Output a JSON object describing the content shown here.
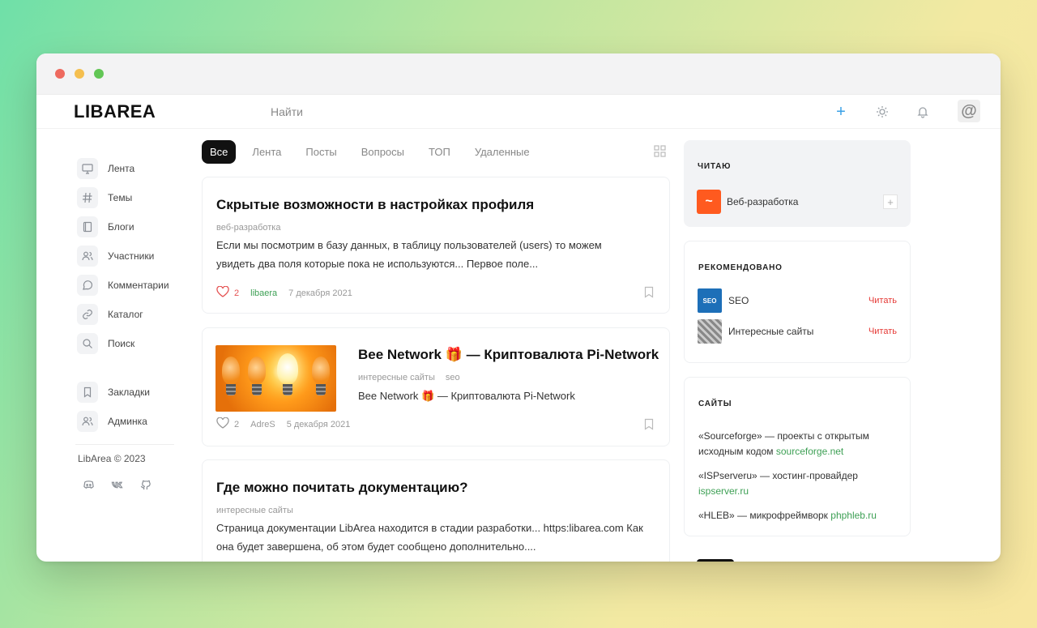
{
  "app": {
    "logo": "LIBAREA",
    "search": "Найти",
    "avatar_glyph": "@"
  },
  "sidebar": {
    "items": [
      {
        "label": "Лента",
        "icon": "monitor-icon"
      },
      {
        "label": "Темы",
        "icon": "hash-icon"
      },
      {
        "label": "Блоги",
        "icon": "book-icon"
      },
      {
        "label": "Участники",
        "icon": "users-icon"
      },
      {
        "label": "Комментарии",
        "icon": "chat-icon"
      },
      {
        "label": "Каталог",
        "icon": "link-icon"
      },
      {
        "label": "Поиск",
        "icon": "search-icon"
      }
    ],
    "items2": [
      {
        "label": "Закладки",
        "icon": "bookmark-icon"
      },
      {
        "label": "Админка",
        "icon": "users-icon"
      }
    ],
    "copyright": "LibArea © 2023"
  },
  "tabs": [
    "Все",
    "Лента",
    "Посты",
    "Вопросы",
    "ТОП",
    "Удаленные"
  ],
  "posts": [
    {
      "title": "Скрытые возможности в настройках профиля",
      "tag": "веб-разработка",
      "text": "Если мы посмотрим в базу данных, в таблицу пользователей (users) то можем увидеть два поля которые пока не используются... Первое поле...",
      "likes": "2",
      "author": "libaera",
      "date": "7 декабря 2021"
    },
    {
      "title": "Bee Network 🎁 — Криптовалюта Pi-Network",
      "tag": "интересные сайты",
      "tag2": "seo",
      "text": "Bee Network 🎁 — Криптовалюта Pi-Network",
      "likes": "2",
      "author": "AdreS",
      "date": "5 декабря 2021"
    },
    {
      "title": "Где можно почитать документацию?",
      "tag": "интересные сайты",
      "text": "Страница документации LibArea находится в стадии разработки... https:libarea.com Как она будет завершена, об этом будет сообщено дополнительно...."
    }
  ],
  "right": {
    "reading": {
      "title": "ЧИТАЮ",
      "blog": "Веб-разработка",
      "blog_glyph": "~",
      "add": "+"
    },
    "recommended": {
      "title": "РЕКОМЕНДОВАНО",
      "items": [
        {
          "label": "SEO",
          "badge": "SEO",
          "action": "Читать"
        },
        {
          "label": "Интересные сайты",
          "action": "Читать"
        }
      ]
    },
    "sites": {
      "title": "САЙТЫ",
      "entries": [
        {
          "text": "«Sourceforge» — проекты с открытым исходным кодом ",
          "link": "sourceforge.net"
        },
        {
          "text": "«ISPserveru» — хостинг-провайдер ",
          "link": "ispserver.ru"
        },
        {
          "text": "«HLEB» — микрофреймворк ",
          "link": "phphleb.ru"
        }
      ]
    }
  },
  "colors": {
    "accent_green": "#3ea055",
    "accent_red": "#e53935",
    "brand_orange": "#ff5a1f",
    "plus_blue": "#3aa0e6"
  }
}
